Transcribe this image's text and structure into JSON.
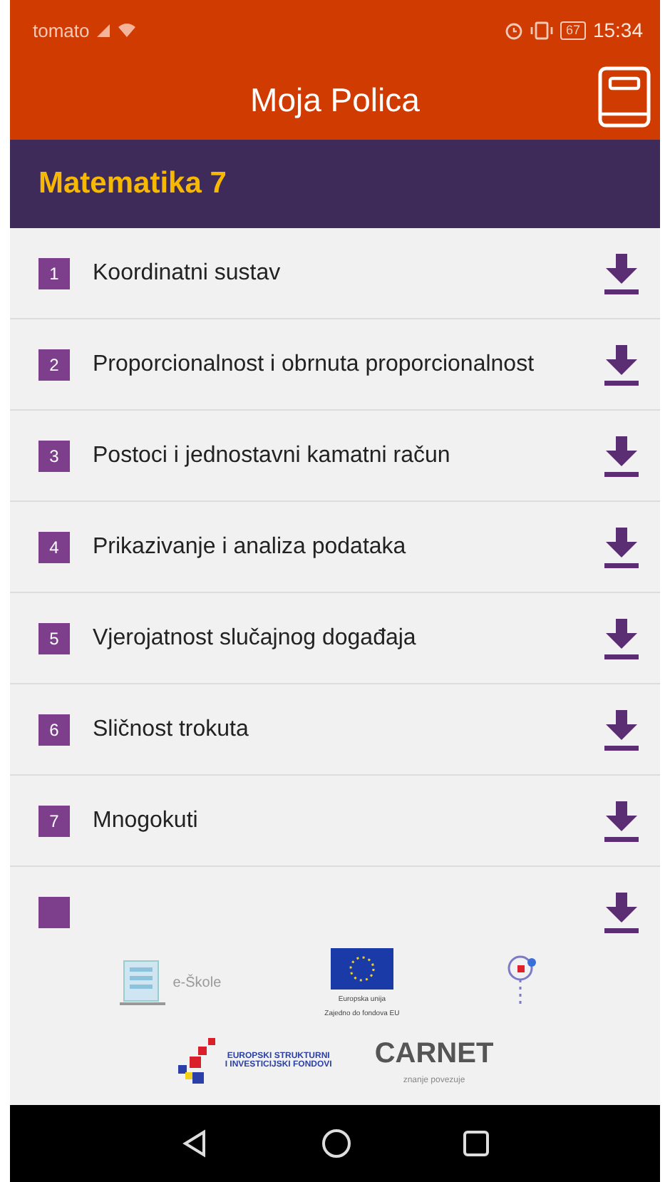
{
  "status_bar": {
    "carrier": "tomato",
    "battery": "67",
    "time": "15:34"
  },
  "app_bar": {
    "title": "Moja Polica"
  },
  "subject": {
    "title": "Matematika 7"
  },
  "chapters": [
    {
      "number": "1",
      "title": "Koordinatni sustav"
    },
    {
      "number": "2",
      "title": "Proporcionalnost i obrnuta proporcionalnost"
    },
    {
      "number": "3",
      "title": "Postoci i jednostavni kamatni račun"
    },
    {
      "number": "4",
      "title": "Prikazivanje i analiza podataka"
    },
    {
      "number": "5",
      "title": "Vjerojatnost slučajnog događaja"
    },
    {
      "number": "6",
      "title": "Sličnost trokuta"
    },
    {
      "number": "7",
      "title": "Mnogokuti"
    }
  ],
  "footer": {
    "eskole": "e-Škole",
    "eu_line_1": "Europska unija",
    "eu_line_2": "Zajedno do fondova EU",
    "esif_line_1": "EUROPSKI STRUKTURNI",
    "esif_line_2": "I INVESTICIJSKI FONDOVI",
    "carnet": "CARNET",
    "carnet_tagline": "znanje povezuje"
  }
}
